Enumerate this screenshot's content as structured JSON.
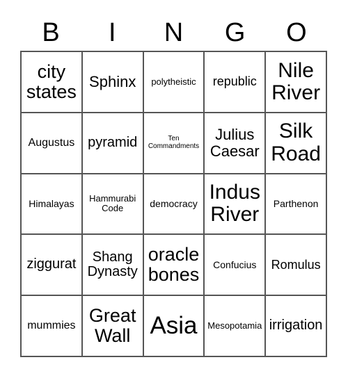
{
  "header": [
    "B",
    "I",
    "N",
    "G",
    "O"
  ],
  "cells": [
    [
      "city states",
      "Sphinx",
      "polytheistic",
      "republic",
      "Nile River"
    ],
    [
      "Augustus",
      "pyramid",
      "Ten Commandments",
      "Julius Caesar",
      "Silk Road"
    ],
    [
      "Himalayas",
      "Hammurabi Code",
      "democracy",
      "Indus River",
      "Parthenon"
    ],
    [
      "ziggurat",
      "Shang Dynasty",
      "oracle bones",
      "Confucius",
      "Romulus"
    ],
    [
      "mummies",
      "Great Wall",
      "Asia",
      "Mesopotamia",
      "irrigation"
    ]
  ]
}
